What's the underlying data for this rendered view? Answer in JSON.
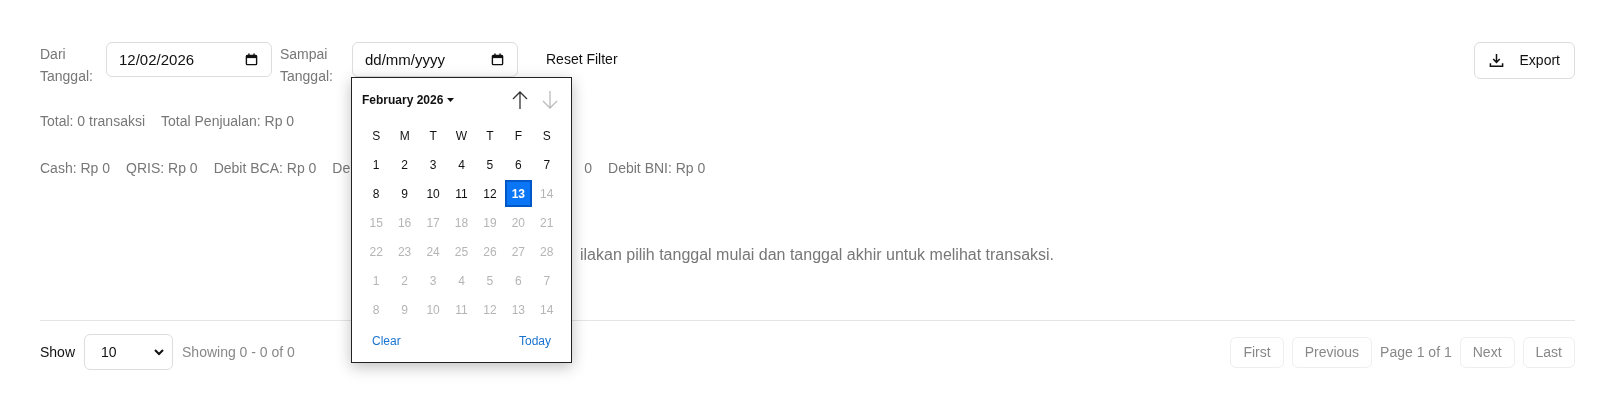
{
  "filters": [
    {
      "label": "Dari Tanggal:",
      "value": "12/02/2026"
    },
    {
      "label": "Sampai Tanggal:",
      "placeholder": "dd/mm/yyyy"
    }
  ],
  "reset_button": "Reset Filter",
  "export_button": "Export",
  "summary": [
    "Total: 0 transaksi",
    "Total Penjualan: Rp 0"
  ],
  "payments_before": [
    "Cash: Rp 0",
    "QRIS: Rp 0",
    "Debit BCA: Rp 0",
    "De"
  ],
  "payments_after": [
    "0",
    "Debit BNI: Rp 0"
  ],
  "message": "ilakan pilih tanggal mulai dan tanggal akhir untuk melihat transaksi.",
  "footer": {
    "show_label": "Show",
    "page_size": "10",
    "showing": "Showing 0 - 0 of 0",
    "pagination": [
      {
        "kind": "button",
        "label": "First",
        "disabled": true
      },
      {
        "kind": "button",
        "label": "Previous",
        "disabled": true
      },
      {
        "kind": "info",
        "label": "Page 1 of 1"
      },
      {
        "kind": "button",
        "label": "Next",
        "disabled": true
      },
      {
        "kind": "button",
        "label": "Last",
        "disabled": true
      }
    ]
  },
  "datepicker": {
    "month": "February 2026",
    "nav": [
      {
        "kind": "up",
        "disabled": false
      },
      {
        "kind": "down",
        "disabled": true
      }
    ],
    "weekdays": [
      "S",
      "M",
      "T",
      "W",
      "T",
      "F",
      "S"
    ],
    "weeks": [
      [
        {
          "label": "1",
          "disabled": false,
          "selected": false
        },
        {
          "label": "2",
          "disabled": false,
          "selected": false
        },
        {
          "label": "3",
          "disabled": false,
          "selected": false
        },
        {
          "label": "4",
          "disabled": false,
          "selected": false
        },
        {
          "label": "5",
          "disabled": false,
          "selected": false
        },
        {
          "label": "6",
          "disabled": false,
          "selected": false
        },
        {
          "label": "7",
          "disabled": false,
          "selected": false
        }
      ],
      [
        {
          "label": "8",
          "disabled": false,
          "selected": false
        },
        {
          "label": "9",
          "disabled": false,
          "selected": false
        },
        {
          "label": "10",
          "disabled": false,
          "selected": false
        },
        {
          "label": "11",
          "disabled": false,
          "selected": false
        },
        {
          "label": "12",
          "disabled": false,
          "selected": false
        },
        {
          "label": "13",
          "disabled": false,
          "selected": true
        },
        {
          "label": "14",
          "disabled": true,
          "selected": false
        }
      ],
      [
        {
          "label": "15",
          "disabled": true,
          "selected": false
        },
        {
          "label": "16",
          "disabled": true,
          "selected": false
        },
        {
          "label": "17",
          "disabled": true,
          "selected": false
        },
        {
          "label": "18",
          "disabled": true,
          "selected": false
        },
        {
          "label": "19",
          "disabled": true,
          "selected": false
        },
        {
          "label": "20",
          "disabled": true,
          "selected": false
        },
        {
          "label": "21",
          "disabled": true,
          "selected": false
        }
      ],
      [
        {
          "label": "22",
          "disabled": true,
          "selected": false
        },
        {
          "label": "23",
          "disabled": true,
          "selected": false
        },
        {
          "label": "24",
          "disabled": true,
          "selected": false
        },
        {
          "label": "25",
          "disabled": true,
          "selected": false
        },
        {
          "label": "26",
          "disabled": true,
          "selected": false
        },
        {
          "label": "27",
          "disabled": true,
          "selected": false
        },
        {
          "label": "28",
          "disabled": true,
          "selected": false
        }
      ],
      [
        {
          "label": "1",
          "disabled": true,
          "selected": false
        },
        {
          "label": "2",
          "disabled": true,
          "selected": false
        },
        {
          "label": "3",
          "disabled": true,
          "selected": false
        },
        {
          "label": "4",
          "disabled": true,
          "selected": false
        },
        {
          "label": "5",
          "disabled": true,
          "selected": false
        },
        {
          "label": "6",
          "disabled": true,
          "selected": false
        },
        {
          "label": "7",
          "disabled": true,
          "selected": false
        }
      ],
      [
        {
          "label": "8",
          "disabled": true,
          "selected": false
        },
        {
          "label": "9",
          "disabled": true,
          "selected": false
        },
        {
          "label": "10",
          "disabled": true,
          "selected": false
        },
        {
          "label": "11",
          "disabled": true,
          "selected": false
        },
        {
          "label": "12",
          "disabled": true,
          "selected": false
        },
        {
          "label": "13",
          "disabled": true,
          "selected": false
        },
        {
          "label": "14",
          "disabled": true,
          "selected": false
        }
      ]
    ],
    "clear": "Clear",
    "today": "Today"
  }
}
